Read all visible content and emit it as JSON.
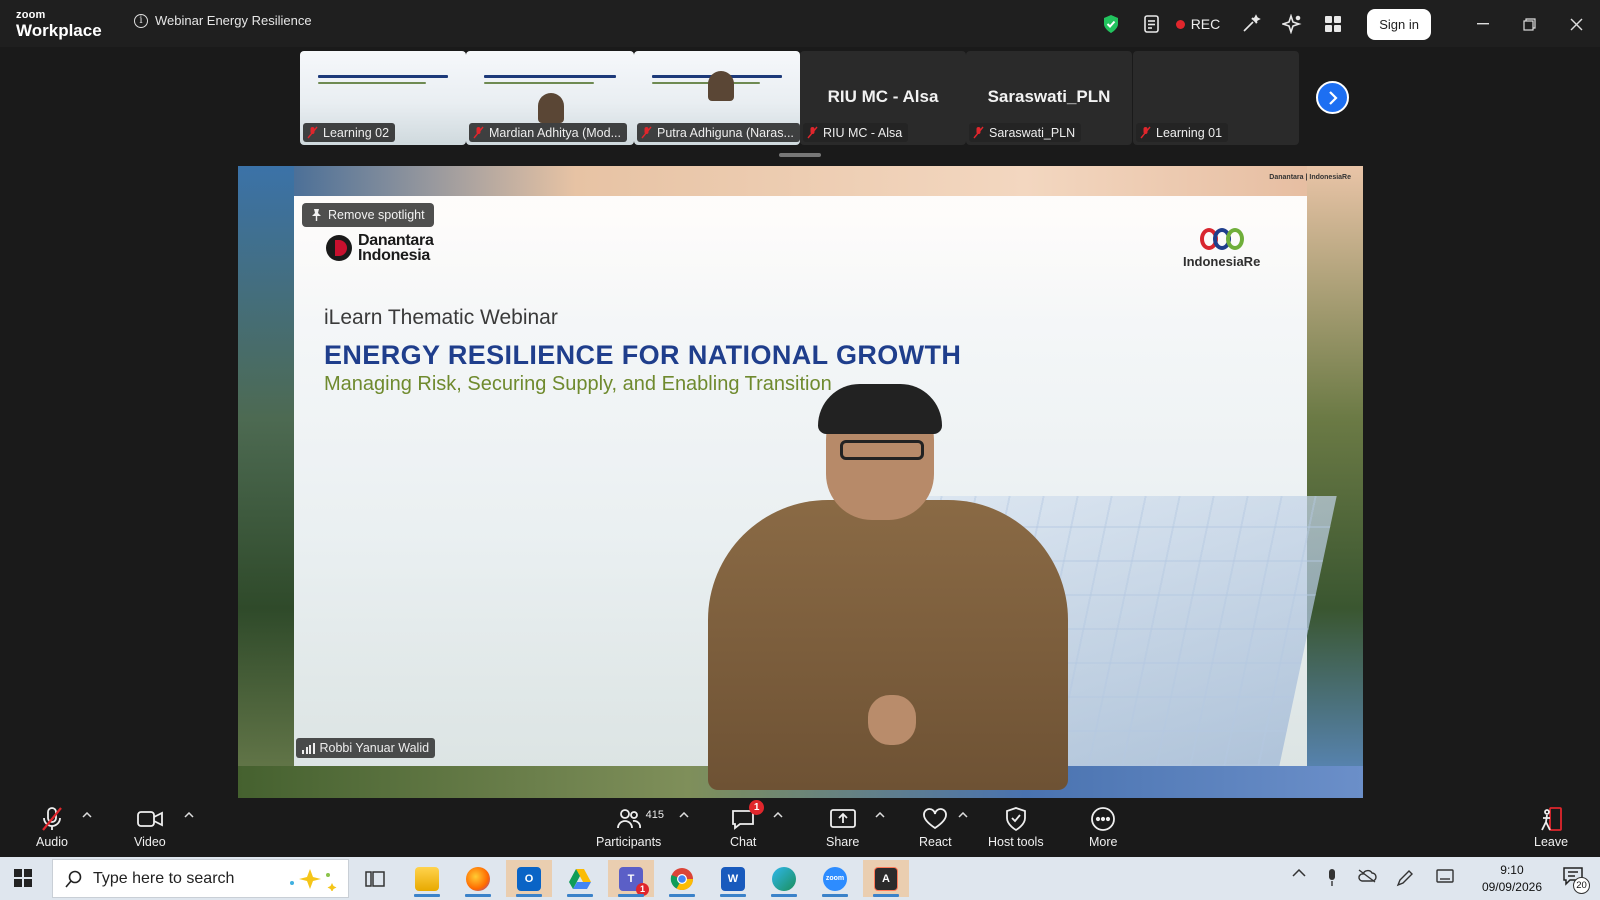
{
  "app": {
    "brand_line1": "zoom",
    "brand_line2": "Workplace",
    "meeting_title": "Webinar Energy Resilience"
  },
  "titlebar": {
    "rec_label": "REC",
    "signin_label": "Sign in"
  },
  "thumbnails": [
    {
      "name": "Learning 02",
      "big_name": ""
    },
    {
      "name": "Mardian Adhitya (Mod...",
      "big_name": ""
    },
    {
      "name": "Putra Adhiguna (Naras...",
      "big_name": ""
    },
    {
      "name": "RIU MC - Alsa",
      "big_name": "RIU MC - Alsa"
    },
    {
      "name": "Saraswati_PLN",
      "big_name": "Saraswati_PLN"
    },
    {
      "name": "Learning 01",
      "big_name": ""
    }
  ],
  "main_video": {
    "spotlight_label": "Remove spotlight",
    "speaker_name": "Robbi Yanuar Walid",
    "slide": {
      "org_left": "Danantara\nIndonesia",
      "org_right": "IndonesiaRe",
      "corner_logos": "Danantara | IndonesiaRe",
      "kicker": "iLearn Thematic Webinar",
      "title": "ENERGY RESILIENCE FOR NATIONAL GROWTH",
      "subtitle": "Managing Risk, Securing Supply, and Enabling Transition"
    }
  },
  "toolbar": {
    "audio": "Audio",
    "video": "Video",
    "participants": "Participants",
    "participants_count": "415",
    "chat": "Chat",
    "chat_badge": "1",
    "share": "Share",
    "react": "React",
    "host_tools": "Host tools",
    "more": "More",
    "leave": "Leave"
  },
  "taskbar": {
    "search_placeholder": "Type here to search",
    "time": "9:10",
    "date": "09/09/2026",
    "notifications": "20",
    "teams_badge": "1"
  },
  "colors": {
    "accent": "#1d6ff2",
    "rec": "#e0262c",
    "slide_title": "#1f3e8c",
    "slide_subtitle": "#6f8a2e"
  }
}
